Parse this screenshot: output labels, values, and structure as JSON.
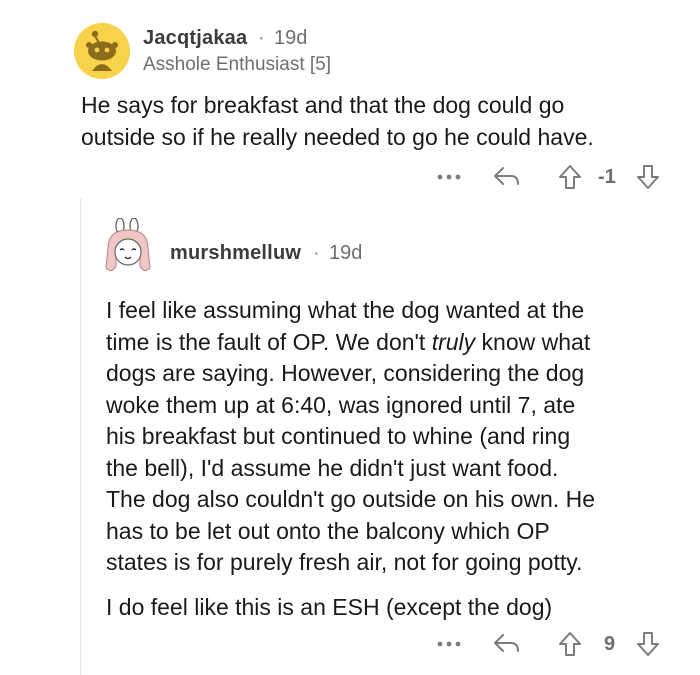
{
  "comment1": {
    "username": "Jacqtjakaa",
    "separator": "·",
    "age": "19d",
    "flair": "Asshole Enthusiast [5]",
    "body_lines": [
      "He says for breakfast and that the dog could go",
      "outside so if he really needed to go he could have."
    ],
    "actions": {
      "more": "more-icon",
      "reply": "reply-icon",
      "upvote": "upvote-icon",
      "score": "-1",
      "downvote": "downvote-icon"
    }
  },
  "comment2": {
    "username": "murshmelluw",
    "separator": "·",
    "age": "19d",
    "paragraph1_lines": [
      "I feel like assuming what the dog wanted at the",
      "time is the fault of OP. We don't ",
      "truly",
      " know what",
      "dogs are saying. However, considering the dog",
      "woke them up at 6:40, was ignored until 7, ate",
      "his breakfast but continued to whine (and ring",
      "the bell), I'd assume he didn't just want food.",
      "The dog also couldn't go outside on his own. He",
      "has to be let out onto the balcony which OP",
      "states is for purely fresh air, not for going potty."
    ],
    "paragraph2": "I do feel like this is an ESH (except the dog)",
    "actions": {
      "more": "more-icon",
      "reply": "reply-icon",
      "upvote": "upvote-icon",
      "score": "9",
      "downvote": "downvote-icon"
    }
  },
  "colors": {
    "text": "#1a1a1b",
    "meta": "#6f6f6f",
    "icon": "#7c7c7c",
    "thread_line": "#e4e6e8",
    "avatar1_bg": "#f7d24a"
  }
}
